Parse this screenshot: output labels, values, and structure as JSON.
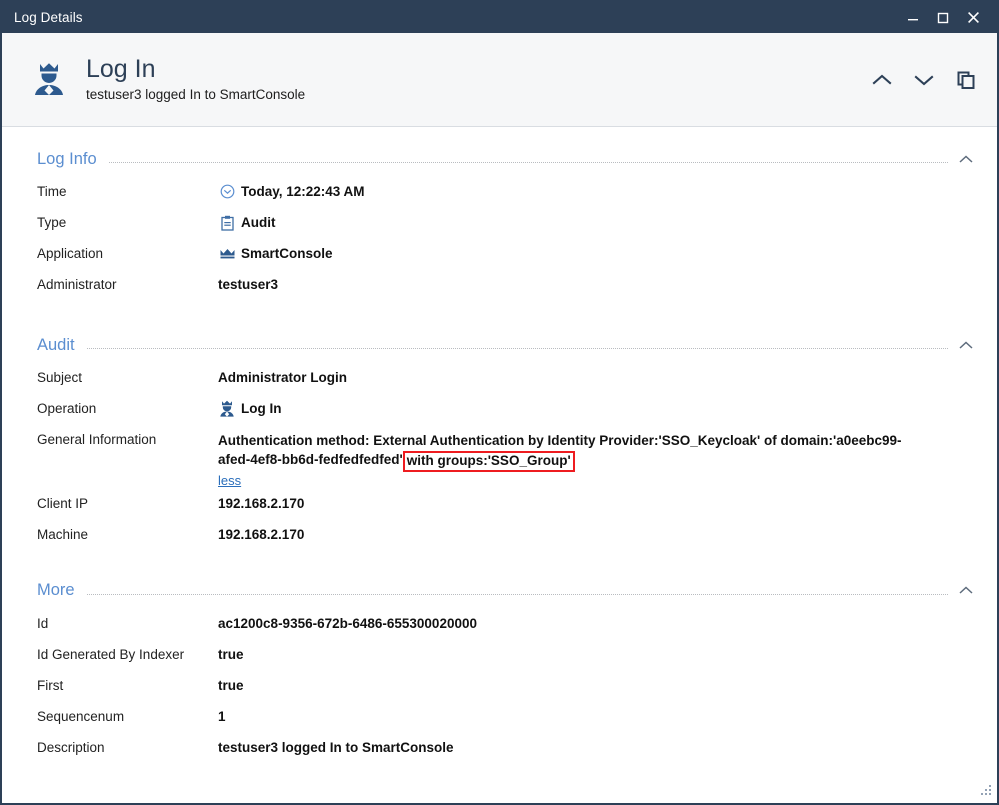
{
  "window": {
    "title": "Log Details",
    "buttons": {
      "minimize": "minimize-button",
      "maximize": "maximize-button",
      "close": "close-button"
    }
  },
  "header": {
    "title": "Log In",
    "subtitle": "testuser3 logged In to SmartConsole",
    "icon": "admin-crown-icon",
    "actions": {
      "previous": "Previous",
      "next": "Next",
      "copy": "Copy"
    }
  },
  "sections": [
    {
      "id": "log-info",
      "title": "Log Info",
      "rows": [
        {
          "label": "Time",
          "value": "Today, 12:22:43 AM",
          "icon": "clock-icon"
        },
        {
          "label": "Type",
          "value": "Audit",
          "icon": "clipboard-icon"
        },
        {
          "label": "Application",
          "value": "SmartConsole",
          "icon": "crown-icon"
        },
        {
          "label": "Administrator",
          "value": "testuser3",
          "icon": null
        }
      ]
    },
    {
      "id": "audit",
      "title": "Audit",
      "rows": [
        {
          "label": "Subject",
          "value": "Administrator Login",
          "icon": null
        },
        {
          "label": "Operation",
          "value": "Log In",
          "icon": "admin-crown-icon"
        }
      ],
      "general_information": {
        "label": "General Information",
        "text_before": "Authentication method: External Authentication by Identity Provider:'SSO_Keycloak' of domain:'a0eebc99-afed-4ef8-bb6d-fedfedfedfed'",
        "highlighted_text": "with groups:'SSO_Group'",
        "toggle_link": "less",
        "highlight_color": "#ee1c20"
      },
      "rows_after": [
        {
          "label": "Client IP",
          "value": "192.168.2.170",
          "icon": null
        },
        {
          "label": "Machine",
          "value": "192.168.2.170",
          "icon": null
        }
      ]
    },
    {
      "id": "more",
      "title": "More",
      "rows": [
        {
          "label": "Id",
          "value": "ac1200c8-9356-672b-6486-655300020000",
          "icon": null
        },
        {
          "label": "Id Generated By Indexer",
          "value": "true",
          "icon": null
        },
        {
          "label": "First",
          "value": "true",
          "icon": null
        },
        {
          "label": "Sequencenum",
          "value": "1",
          "icon": null
        },
        {
          "label": "Description",
          "value": "testuser3 logged In to SmartConsole",
          "icon": null
        }
      ]
    }
  ],
  "colors": {
    "titlebar": "#2d4057",
    "accent": "#5b8ed0",
    "link": "#2a6ebb",
    "header_band": "#f6f7f8"
  }
}
